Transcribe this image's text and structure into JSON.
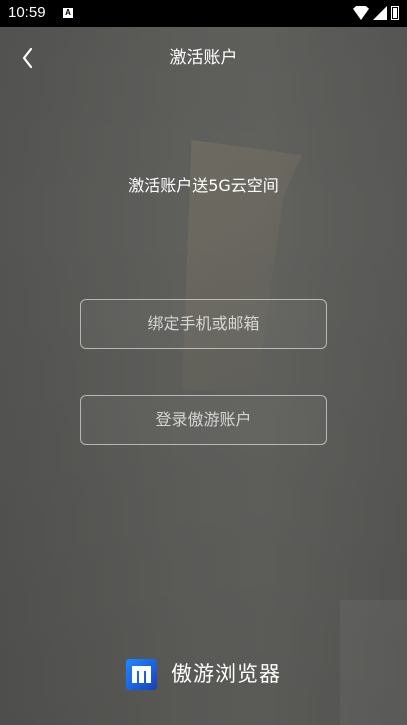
{
  "status_bar": {
    "time": "10:59",
    "notification_icon_letter": "A",
    "icons": [
      "wifi-icon",
      "signal-icon",
      "battery-icon"
    ]
  },
  "header": {
    "title": "激活账户",
    "back_icon": "chevron-left-icon"
  },
  "content": {
    "promo_text": "激活账户送5G云空间",
    "bind_button_label": "绑定手机或邮箱",
    "login_button_label": "登录傲游账户"
  },
  "footer": {
    "brand_name": "傲游浏览器",
    "logo_icon": "maxthon-logo"
  },
  "colors": {
    "background": "#5a5a58",
    "text": "#ffffff",
    "button_border": "#bfbfbf",
    "logo_blue": "#1b5edc"
  }
}
